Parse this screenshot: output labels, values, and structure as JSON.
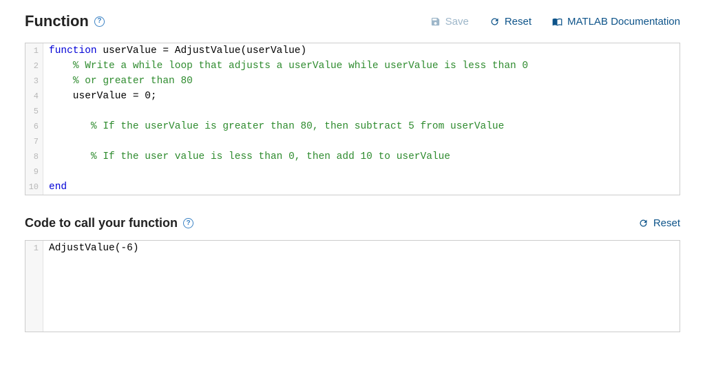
{
  "section1": {
    "title": "Function",
    "help_glyph": "?",
    "actions": {
      "save": "Save",
      "reset": "Reset",
      "docs": "MATLAB Documentation"
    },
    "code": {
      "lines": [
        {
          "num": "1",
          "tokens": [
            {
              "t": "function",
              "c": "keyword"
            },
            {
              "t": " userValue = AdjustValue(userValue)",
              "c": "plain"
            }
          ]
        },
        {
          "num": "2",
          "tokens": [
            {
              "t": "    ",
              "c": "plain"
            },
            {
              "t": "% Write a while loop that adjusts a userValue while userValue is less than 0",
              "c": "comment"
            }
          ]
        },
        {
          "num": "3",
          "tokens": [
            {
              "t": "    ",
              "c": "plain"
            },
            {
              "t": "% or greater than 80",
              "c": "comment"
            }
          ]
        },
        {
          "num": "4",
          "tokens": [
            {
              "t": "    userValue = 0;",
              "c": "plain"
            }
          ]
        },
        {
          "num": "5",
          "tokens": [
            {
              "t": "",
              "c": "plain"
            }
          ]
        },
        {
          "num": "6",
          "tokens": [
            {
              "t": "       ",
              "c": "plain"
            },
            {
              "t": "% If the userValue is greater than 80, then subtract 5 from userValue",
              "c": "comment"
            }
          ]
        },
        {
          "num": "7",
          "tokens": [
            {
              "t": "",
              "c": "plain"
            }
          ]
        },
        {
          "num": "8",
          "tokens": [
            {
              "t": "       ",
              "c": "plain"
            },
            {
              "t": "% If the user value is less than 0, then add 10 to userValue",
              "c": "comment"
            }
          ]
        },
        {
          "num": "9",
          "tokens": [
            {
              "t": "",
              "c": "plain"
            }
          ]
        },
        {
          "num": "10",
          "tokens": [
            {
              "t": "end",
              "c": "keyword"
            }
          ]
        }
      ]
    }
  },
  "section2": {
    "title": "Code to call your function",
    "help_glyph": "?",
    "actions": {
      "reset": "Reset"
    },
    "code": {
      "lines": [
        {
          "num": "1",
          "tokens": [
            {
              "t": "AdjustValue(-6)",
              "c": "plain"
            }
          ]
        }
      ]
    }
  }
}
